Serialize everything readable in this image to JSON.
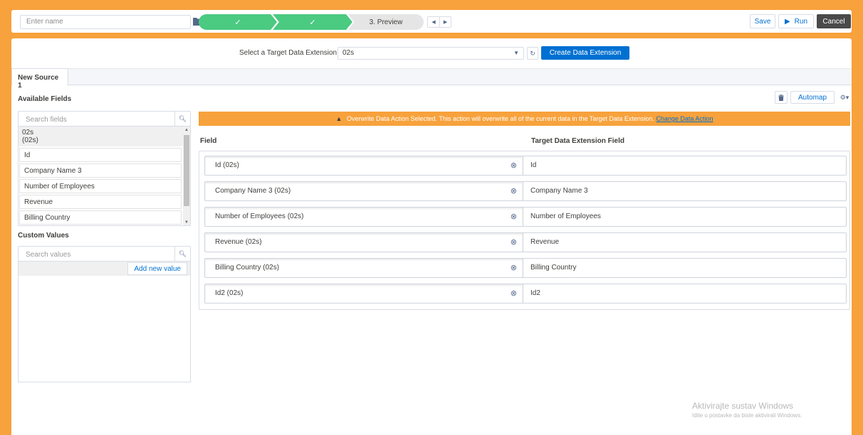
{
  "topbar": {
    "name_placeholder": "Enter name",
    "steps": [
      {
        "label": "✓",
        "state": "complete"
      },
      {
        "label": "✓",
        "state": "complete"
      },
      {
        "label": "3. Preview",
        "state": "current"
      }
    ],
    "save_label": "Save",
    "run_label": "Run",
    "cancel_label": "Cancel"
  },
  "target": {
    "label": "Select a Target Data Extension:",
    "selected": "02s",
    "create_label": "Create Data Extension"
  },
  "tabs": [
    {
      "label": "New Source 1",
      "active": true
    }
  ],
  "available_fields": {
    "title": "Available Fields",
    "search_placeholder": "Search fields",
    "group_name": "02s",
    "group_sub": "(02s)",
    "items": [
      "Id",
      "Company Name 3",
      "Number of Employees",
      "Revenue",
      "Billing Country"
    ]
  },
  "custom_values": {
    "title": "Custom Values",
    "search_placeholder": "Search values",
    "add_label": "Add new value"
  },
  "toolbar": {
    "automap_label": "Automap"
  },
  "warning": {
    "message": "Overwrite Data Action Selected. This action will overwrite all of the current data in the Target Data Extension.",
    "link": "Change Data Action"
  },
  "mapping": {
    "field_header": "Field",
    "target_header": "Target Data Extension Field",
    "rows": [
      {
        "source": "Id (02s)",
        "target": "Id"
      },
      {
        "source": "Company Name 3 (02s)",
        "target": "Company Name 3"
      },
      {
        "source": "Number of Employees (02s)",
        "target": "Number of Employees"
      },
      {
        "source": "Revenue (02s)",
        "target": "Revenue"
      },
      {
        "source": "Billing Country (02s)",
        "target": "Billing Country"
      },
      {
        "source": "Id2 (02s)",
        "target": "Id2"
      }
    ]
  },
  "watermark": {
    "line1": "Aktivirajte sustav Windows",
    "line2": "Idite u postavke da biste aktivirali Windows."
  },
  "colors": {
    "accent": "#0070d2",
    "frame": "#f7a23c",
    "step_done": "#4bca81"
  }
}
